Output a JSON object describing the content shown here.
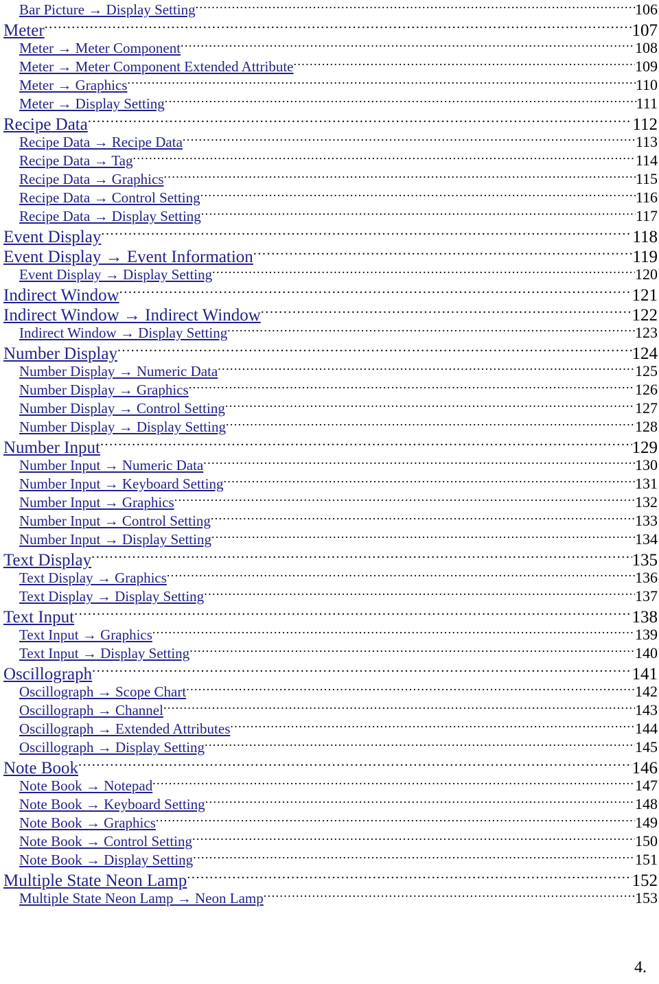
{
  "document": {
    "kind": "table-of-contents",
    "text_color": "#22228a",
    "page_number_color": "#000000",
    "footer": "4."
  },
  "toc": {
    "entries": [
      {
        "title": "Bar Picture → Display Setting ",
        "page": "106",
        "level": 2
      },
      {
        "title": "Meter",
        "page": "107",
        "level": 1
      },
      {
        "title": "Meter → Meter Component ",
        "page": "108",
        "level": 2
      },
      {
        "title": "Meter → Meter Component Extended Attribute ",
        "page": "109",
        "level": 2
      },
      {
        "title": "Meter → Graphics ",
        "page": "110",
        "level": 2
      },
      {
        "title": "Meter → Display Setting ",
        "page": "111",
        "level": 2
      },
      {
        "title": "Recipe Data",
        "page": "112",
        "level": 1
      },
      {
        "title": "Recipe Data → Recipe Data ",
        "page": "113",
        "level": 2
      },
      {
        "title": "Recipe Data → Tag ",
        "page": "114",
        "level": 2
      },
      {
        "title": "Recipe Data → Graphics ",
        "page": "115",
        "level": 2
      },
      {
        "title": "Recipe Data → Control Setting ",
        "page": "116",
        "level": 2
      },
      {
        "title": "Recipe Data → Display Setting ",
        "page": "117",
        "level": 2
      },
      {
        "title": "Event Display",
        "page": "118",
        "level": 1
      },
      {
        "title": "Event Display → Event Information ",
        "page": "119",
        "level": 1
      },
      {
        "title": "Event Display → Display Setting ",
        "page": "120",
        "level": 2
      },
      {
        "title": "Indirect Window",
        "page": "121",
        "level": 1
      },
      {
        "title": "Indirect Window → Indirect Window ",
        "page": "122",
        "level": 1
      },
      {
        "title": "Indirect Window → Display Setting ",
        "page": "123",
        "level": 2
      },
      {
        "title": "Number Display",
        "page": "124",
        "level": 1
      },
      {
        "title": "Number Display → Numeric Data ",
        "page": "125",
        "level": 2
      },
      {
        "title": "Number Display → Graphics ",
        "page": "126",
        "level": 2
      },
      {
        "title": "Number Display → Control Setting ",
        "page": "127",
        "level": 2
      },
      {
        "title": "Number Display → Display Setting ",
        "page": "128",
        "level": 2
      },
      {
        "title": "Number Input",
        "page": "129",
        "level": 1
      },
      {
        "title": "Number Input → Numeric Data ",
        "page": "130",
        "level": 2
      },
      {
        "title": "Number Input → Keyboard Setting ",
        "page": "131",
        "level": 2
      },
      {
        "title": "Number Input → Graphics ",
        "page": "132",
        "level": 2
      },
      {
        "title": "Number Input → Control Setting ",
        "page": "133",
        "level": 2
      },
      {
        "title": "Number Input → Display Setting ",
        "page": "134",
        "level": 2
      },
      {
        "title": "Text Display",
        "page": "135",
        "level": 1
      },
      {
        "title": "Text Display → Graphics ",
        "page": "136",
        "level": 2
      },
      {
        "title": "Text Display → Display Setting ",
        "page": "137",
        "level": 2
      },
      {
        "title": "Text Input",
        "page": "138",
        "level": 1
      },
      {
        "title": "Text Input → Graphics ",
        "page": "139",
        "level": 2
      },
      {
        "title": "Text Input → Display Setting ",
        "page": "140",
        "level": 2
      },
      {
        "title": "Oscillograph",
        "page": "141",
        "level": 1
      },
      {
        "title": "Oscillograph → Scope Chart ",
        "page": "142",
        "level": 2
      },
      {
        "title": "Oscillograph → Channel",
        "page": "143",
        "level": 2
      },
      {
        "title": "Oscillograph → Extended Attributes ",
        "page": "144",
        "level": 2
      },
      {
        "title": "Oscillograph → Display Setting ",
        "page": "145",
        "level": 2
      },
      {
        "title": "Note Book",
        "page": "146",
        "level": 1
      },
      {
        "title": "Note Book → Notepad ",
        "page": "147",
        "level": 2
      },
      {
        "title": "Note Book → Keyboard Setting ",
        "page": "148",
        "level": 2
      },
      {
        "title": "Note Book → Graphics ",
        "page": "149",
        "level": 2
      },
      {
        "title": "Note Book → Control Setting ",
        "page": "150",
        "level": 2
      },
      {
        "title": "Note Book → Display Setting ",
        "page": "151",
        "level": 2
      },
      {
        "title": "Multiple State Neon Lamp",
        "page": "152",
        "level": 1
      },
      {
        "title": "Multiple State Neon Lamp → Neon Lamp ",
        "page": "153",
        "level": 2
      }
    ]
  }
}
